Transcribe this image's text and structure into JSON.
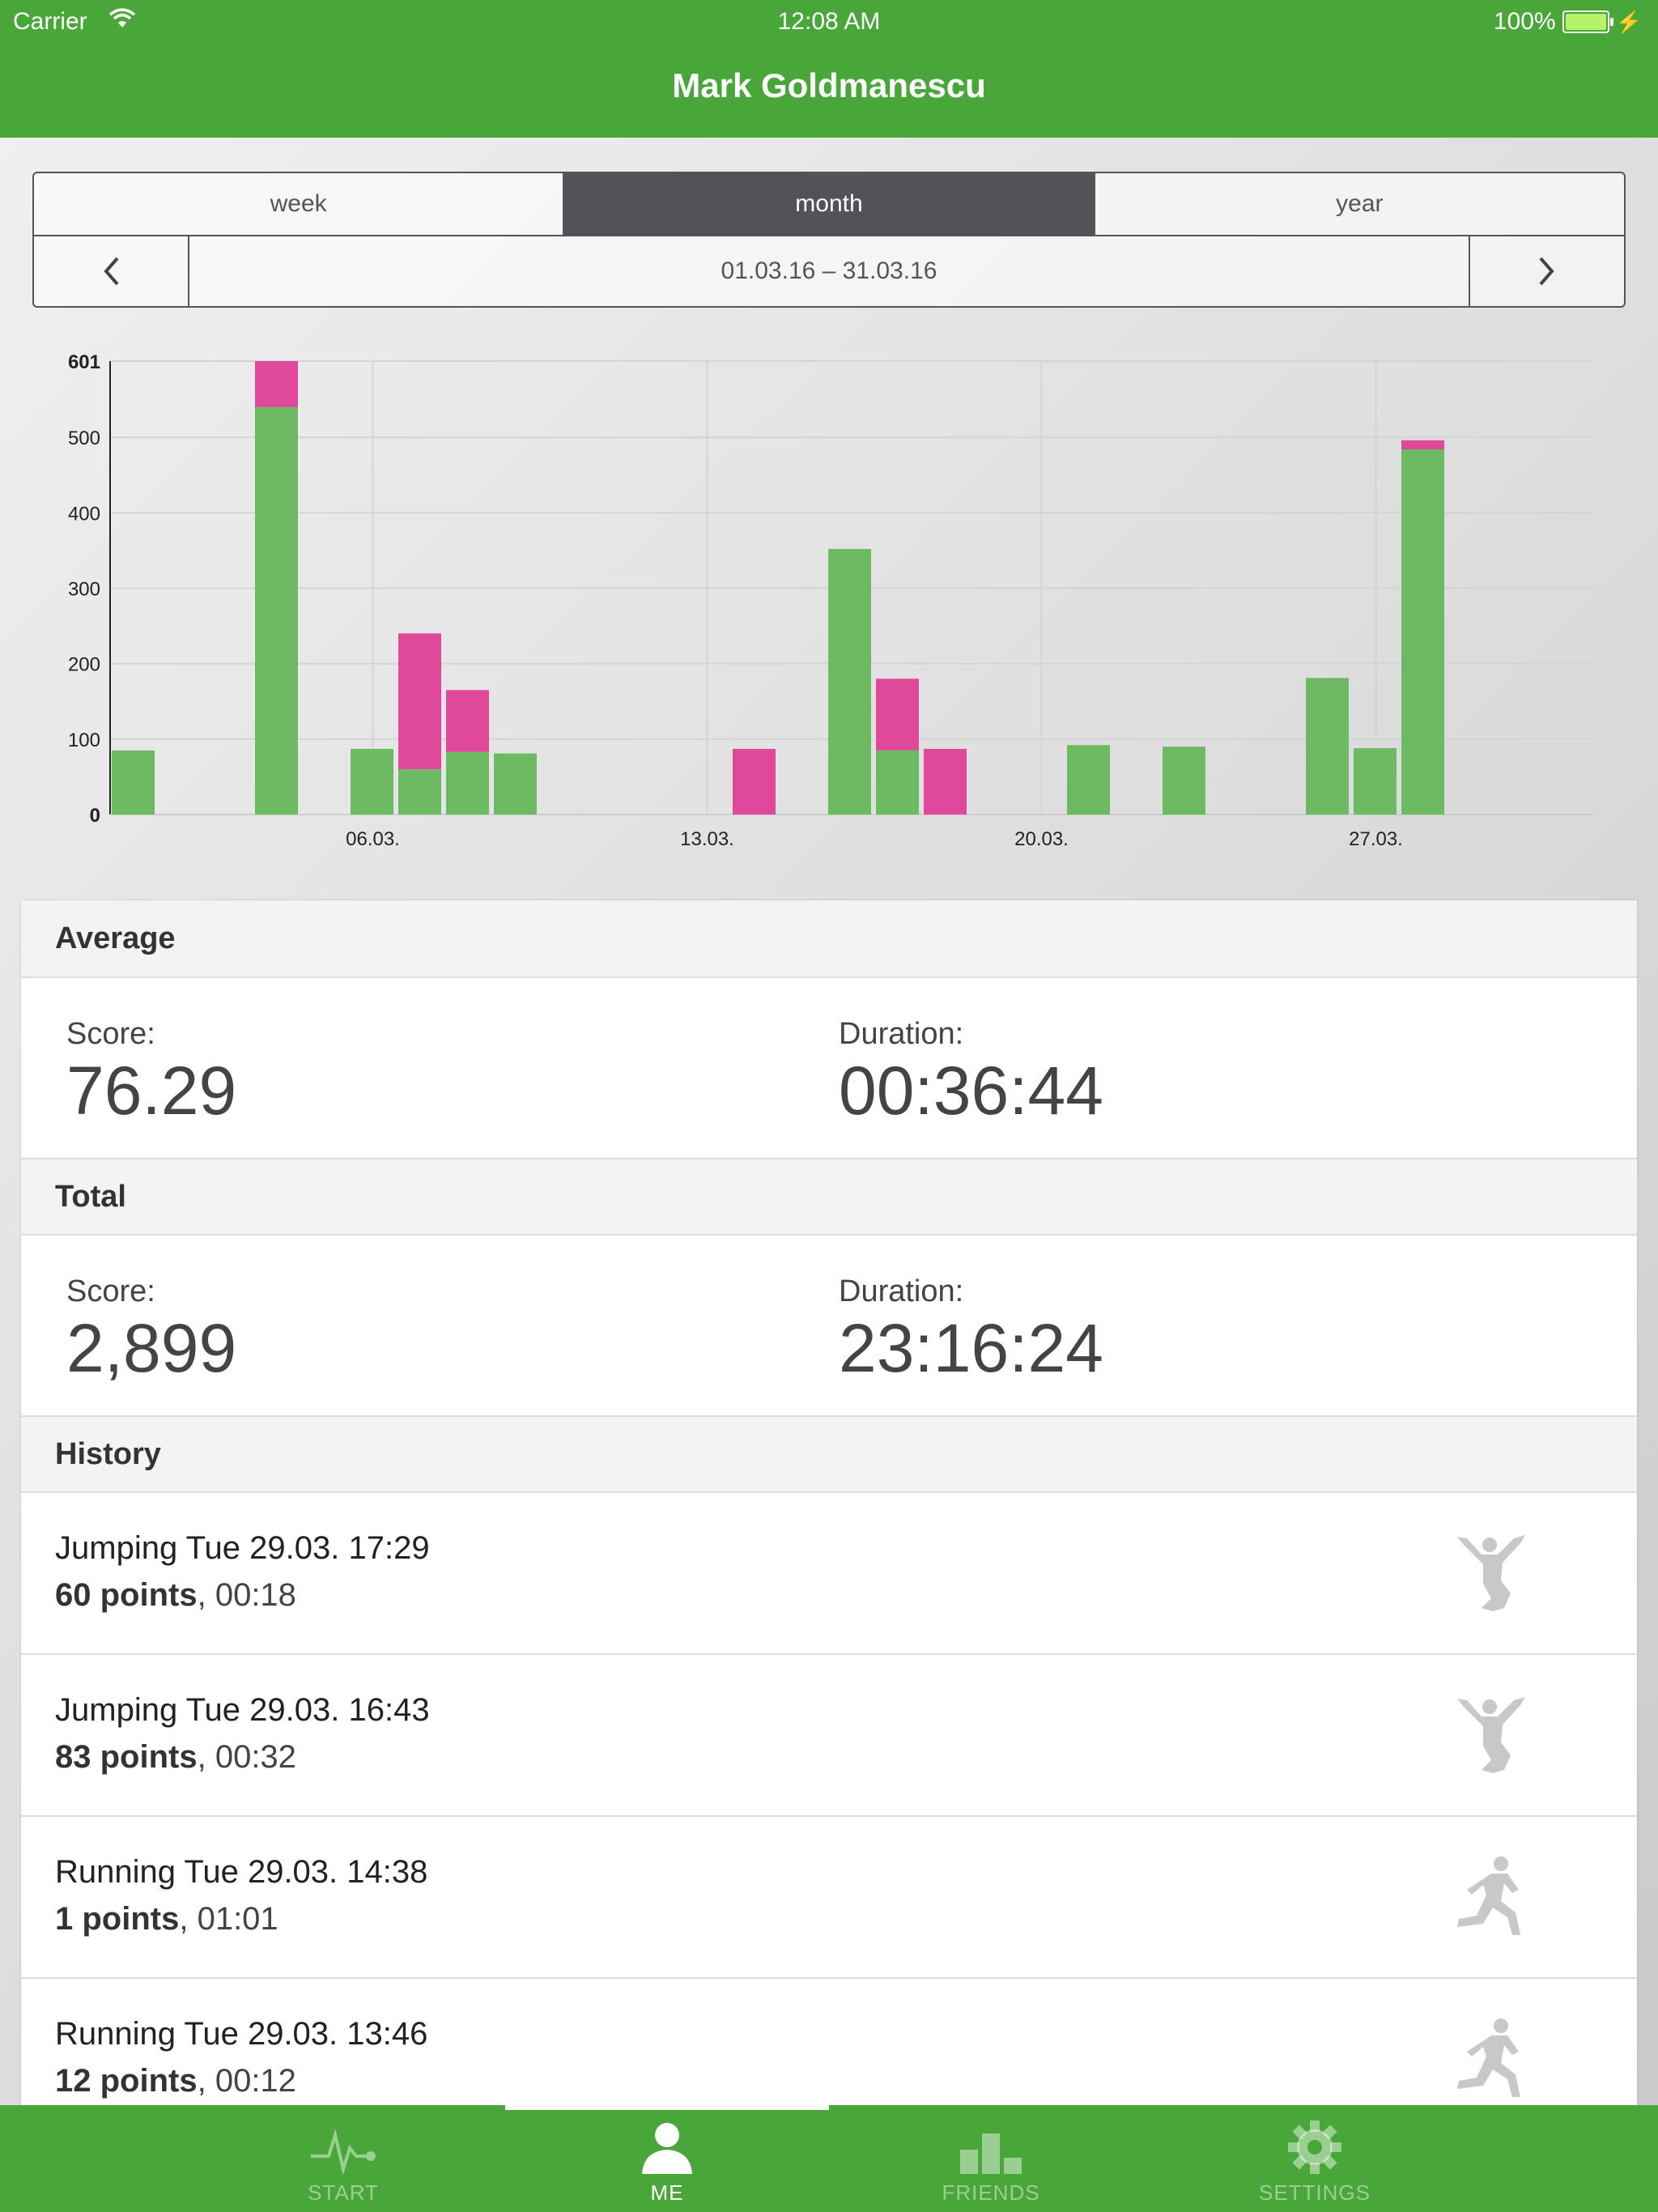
{
  "status_bar": {
    "carrier": "Carrier",
    "time": "12:08 AM",
    "battery": "100%"
  },
  "header": {
    "title": "Mark Goldmanescu"
  },
  "period_tabs": [
    {
      "label": "week",
      "active": false
    },
    {
      "label": "month",
      "active": true
    },
    {
      "label": "year",
      "active": false
    }
  ],
  "date_range": "01.03.16 – 31.03.16",
  "chart_data": {
    "type": "bar",
    "stacked": true,
    "ylim": [
      0,
      601
    ],
    "yticks": [
      "0",
      "100",
      "200",
      "300",
      "400",
      "500",
      "601"
    ],
    "xticks": [
      {
        "day": 6,
        "label": "06.03."
      },
      {
        "day": 13,
        "label": "13.03."
      },
      {
        "day": 20,
        "label": "20.03."
      },
      {
        "day": 27,
        "label": "27.03."
      }
    ],
    "days": [
      1,
      4,
      6,
      7,
      8,
      9,
      14,
      16,
      17,
      18,
      21,
      23,
      26,
      27,
      28
    ],
    "series": [
      {
        "color": "#6cbb62",
        "values": [
          85,
          540,
          87,
          60,
          83,
          81,
          0,
          352,
          85,
          0,
          92,
          90,
          181,
          88,
          484
        ]
      },
      {
        "color": "#e0489c",
        "values": [
          0,
          61,
          0,
          180,
          82,
          0,
          87,
          0,
          95,
          87,
          0,
          0,
          0,
          0,
          12
        ]
      }
    ],
    "grid": true
  },
  "average": {
    "header": "Average",
    "score_label": "Score:",
    "score_value": "76.29",
    "duration_label": "Duration:",
    "duration_value": "00:36:44"
  },
  "total": {
    "header": "Total",
    "score_label": "Score:",
    "score_value": "2,899",
    "duration_label": "Duration:",
    "duration_value": "23:16:24"
  },
  "history": {
    "header": "History",
    "items": [
      {
        "title": "Jumping Tue 29.03. 17:29",
        "points": "60 points",
        "duration": ", 00:18",
        "icon": "jumping-icon"
      },
      {
        "title": "Jumping Tue 29.03. 16:43",
        "points": "83 points",
        "duration": ", 00:32",
        "icon": "jumping-icon"
      },
      {
        "title": "Running Tue 29.03. 14:38",
        "points": "1 points",
        "duration": ", 01:01",
        "icon": "running-icon"
      },
      {
        "title": "Running Tue 29.03. 13:46",
        "points": "12 points",
        "duration": ", 00:12",
        "icon": "running-icon"
      }
    ]
  },
  "tabbar": [
    {
      "label": "START",
      "icon": "pulse-icon",
      "active": false
    },
    {
      "label": "ME",
      "icon": "person-icon",
      "active": true
    },
    {
      "label": "FRIENDS",
      "icon": "podium-icon",
      "active": false
    },
    {
      "label": "SETTINGS",
      "icon": "gear-icon",
      "active": false
    }
  ],
  "colors": {
    "brand_green": "#49a73a",
    "bar_green": "#6cbb62",
    "bar_pink": "#e0489c",
    "tab_active_bg": "#525259"
  }
}
